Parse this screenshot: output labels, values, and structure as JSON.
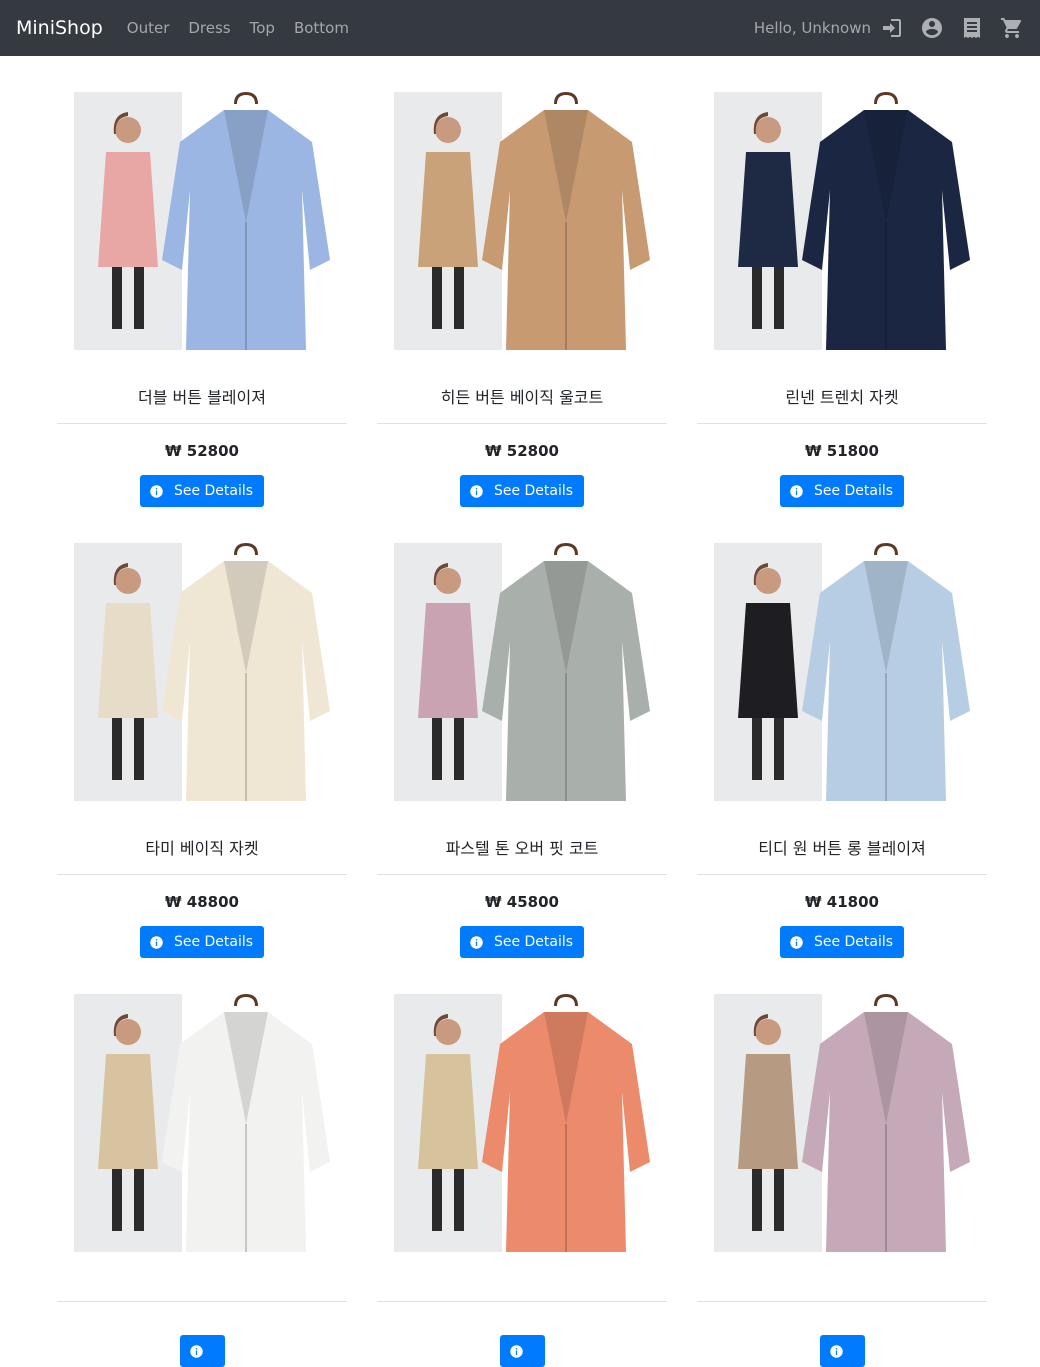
{
  "nav": {
    "brand": "MiniShop",
    "links": [
      "Outer",
      "Dress",
      "Top",
      "Bottom"
    ],
    "greeting": "Hello, Unknown",
    "icons": [
      "login-icon",
      "account-icon",
      "receipt-icon",
      "cart-icon"
    ]
  },
  "products": [
    {
      "name": "더블 버튼 블레이져",
      "price": "₩ 52800",
      "button": "See Details",
      "model_color": "#e8a7a5",
      "coat_color": "#9bb6e2"
    },
    {
      "name": "히든 버튼 베이직 울코트",
      "price": "₩ 52800",
      "button": "See Details",
      "model_color": "#c9a27a",
      "coat_color": "#c79a72"
    },
    {
      "name": "린넨 트렌치 자켓",
      "price": "₩ 51800",
      "button": "See Details",
      "model_color": "#1e2a44",
      "coat_color": "#1b2742"
    },
    {
      "name": "타미 베이직 자켓",
      "price": "₩ 48800",
      "button": "See Details",
      "model_color": "#e6dcc7",
      "coat_color": "#efe6d4"
    },
    {
      "name": "파스텔 톤 오버 핏 코트",
      "price": "₩ 45800",
      "button": "See Details",
      "model_color": "#c9a3b2",
      "coat_color": "#a9afaa"
    },
    {
      "name": "티디 원 버튼 롱 블레이져",
      "price": "₩ 41800",
      "button": "See Details",
      "model_color": "#1d1d22",
      "coat_color": "#b7cde4"
    },
    {
      "name": "",
      "price": "",
      "button": "",
      "model_color": "#d8c3a0",
      "coat_color": "#f2f2f0"
    },
    {
      "name": "",
      "price": "",
      "button": "",
      "model_color": "#d6c29b",
      "coat_color": "#ec8a6c"
    },
    {
      "name": "",
      "price": "",
      "button": "",
      "model_color": "#b79a82",
      "coat_color": "#c5a9b8"
    }
  ],
  "colors": {
    "navbar": "#343a40",
    "primary": "#007bff"
  }
}
